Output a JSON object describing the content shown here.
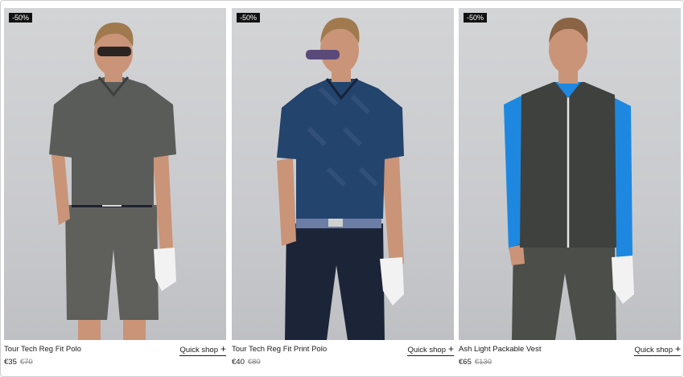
{
  "products": [
    {
      "badge": "-50%",
      "name": "Tour Tech Reg Fit Polo",
      "quick_shop": "Quick shop",
      "quick_icon": "+",
      "price_now": "€35",
      "price_was": "€70",
      "colors": {
        "shirt": "#5a5c5a",
        "shorts": "#5f605c",
        "skin": "#c99478",
        "hair": "#a07a4e"
      }
    },
    {
      "badge": "-50%",
      "name": "Tour Tech Reg Fit Print Polo",
      "quick_shop": "Quick shop",
      "quick_icon": "+",
      "price_now": "€40",
      "price_was": "€80",
      "colors": {
        "shirt": "#23446d",
        "shorts": "#1c2438",
        "skin": "#c99478",
        "hair": "#a07a4e"
      }
    },
    {
      "badge": "-50%",
      "name": "Ash Light Packable Vest",
      "quick_shop": "Quick shop",
      "quick_icon": "+",
      "price_now": "€65",
      "price_was": "€130",
      "colors": {
        "vest": "#3e413d",
        "sleeve": "#1e88e0",
        "pants": "#4c4e4a",
        "skin": "#c99478",
        "hair": "#8a6444"
      }
    }
  ]
}
